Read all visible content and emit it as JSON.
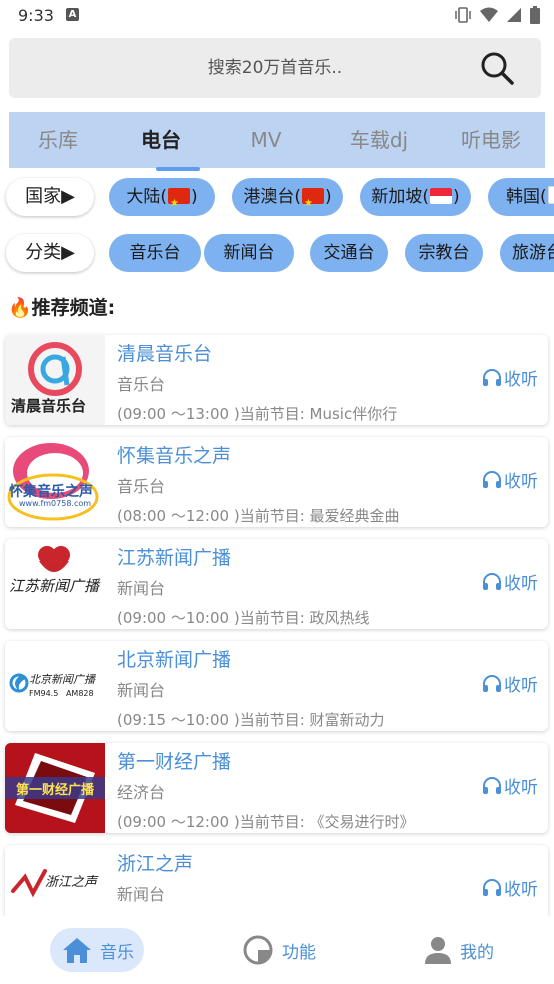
{
  "status": {
    "time": "9:33",
    "notif": "A"
  },
  "search": {
    "placeholder": "搜索20万首音乐.."
  },
  "tabs": [
    {
      "label": "乐库"
    },
    {
      "label": "电台"
    },
    {
      "label": "MV"
    },
    {
      "label": "车载dj"
    },
    {
      "label": "听电影"
    }
  ],
  "country_filter": {
    "label": "国家▶",
    "chips": [
      "大陆(",
      ")",
      "港澳台(",
      ")",
      "新加坡(",
      ")",
      "韩国("
    ]
  },
  "category_filter": {
    "label": "分类▶",
    "chips": [
      "音乐台",
      "新闻台",
      "交通台",
      "宗教台",
      "旅游台"
    ]
  },
  "section": {
    "title": "推荐频道:"
  },
  "channels": [
    {
      "name": "清晨音乐台",
      "category": "音乐台",
      "schedule": "(09:00 ～13:00 )当前节目:   Music伴你行",
      "listen": "收听",
      "logo_text": "清晨音乐台"
    },
    {
      "name": "怀集音乐之声",
      "category": "音乐台",
      "schedule": "(08:00 ～12:00 )当前节目:   最爱经典金曲",
      "listen": "收听",
      "logo_text": "怀集音乐之声",
      "logo_sub": "www.fm0758.com"
    },
    {
      "name": "江苏新闻广播",
      "category": "新闻台",
      "schedule": "(09:00 ～10:00 )当前节目:   政风热线",
      "listen": "收听",
      "logo_text": "江苏新闻广播"
    },
    {
      "name": "北京新闻广播",
      "category": "新闻台",
      "schedule": "(09:15 ～10:00 )当前节目:   财富新动力",
      "listen": "收听",
      "logo_text": "北京新闻广播",
      "logo_sub": "FM94.5   AM828"
    },
    {
      "name": "第一财经广播",
      "category": "经济台",
      "schedule": "(09:00 ～12:00 )当前节目:   《交易进行时》",
      "listen": "收听",
      "logo_text": "第一财经广播"
    },
    {
      "name": "浙江之声",
      "category": "新闻台",
      "schedule": "",
      "listen": "收听",
      "logo_text": "浙江之声"
    }
  ],
  "bottom_nav": [
    {
      "label": "音乐"
    },
    {
      "label": "功能"
    },
    {
      "label": "我的"
    }
  ],
  "colors": {
    "accent": "#4a8fd8",
    "chip": "#7eb1ef",
    "tab_bar": "#bcd3f2"
  }
}
